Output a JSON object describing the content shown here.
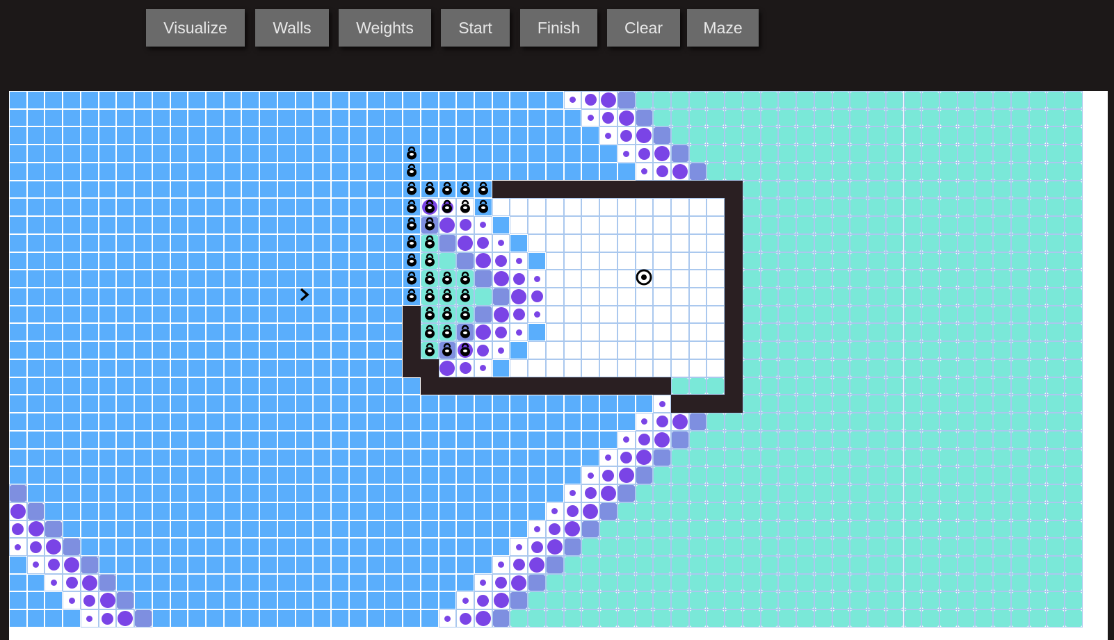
{
  "toolbar": {
    "buttons": [
      {
        "id": "visualize",
        "label": "Visualize"
      },
      {
        "id": "walls",
        "label": "Walls"
      },
      {
        "id": "weights",
        "label": "Weights"
      },
      {
        "id": "start",
        "label": "Start"
      },
      {
        "id": "finish",
        "label": "Finish"
      },
      {
        "id": "clear",
        "label": "Clear"
      },
      {
        "id": "maze",
        "label": "Maze"
      }
    ]
  },
  "grid": {
    "cols": 60,
    "rows": 30,
    "start_node": {
      "row": 11,
      "col": 16,
      "icon": "chevron-right-icon"
    },
    "finish_node": {
      "row": 10,
      "col": 35,
      "icon": "target-icon"
    },
    "colors": {
      "visited": "#5aaefc",
      "wave_teal": "#7ae8d8",
      "wave_aqua": "#8fd6d0",
      "wave_blue_violet": "#7e8fe0",
      "frontier_violet": "#7a44e6",
      "wall": "#2a1f22",
      "empty": "#ffffff",
      "grid_line": "#aac8ee"
    },
    "walls": [
      [
        5,
        27
      ],
      [
        5,
        28
      ],
      [
        5,
        29
      ],
      [
        5,
        30
      ],
      [
        5,
        31
      ],
      [
        5,
        32
      ],
      [
        5,
        33
      ],
      [
        5,
        34
      ],
      [
        5,
        35
      ],
      [
        5,
        36
      ],
      [
        5,
        37
      ],
      [
        5,
        38
      ],
      [
        5,
        39
      ],
      [
        5,
        40
      ],
      [
        6,
        40
      ],
      [
        7,
        40
      ],
      [
        8,
        40
      ],
      [
        9,
        40
      ],
      [
        10,
        40
      ],
      [
        11,
        40
      ],
      [
        12,
        40
      ],
      [
        13,
        40
      ],
      [
        14,
        40
      ],
      [
        15,
        40
      ],
      [
        16,
        40
      ],
      [
        12,
        22
      ],
      [
        13,
        22
      ],
      [
        14,
        22
      ],
      [
        15,
        22
      ],
      [
        15,
        23
      ],
      [
        16,
        23
      ],
      [
        16,
        24
      ],
      [
        16,
        25
      ],
      [
        16,
        26
      ],
      [
        16,
        27
      ],
      [
        16,
        28
      ],
      [
        16,
        29
      ],
      [
        16,
        30
      ],
      [
        16,
        31
      ],
      [
        16,
        32
      ],
      [
        16,
        33
      ],
      [
        16,
        34
      ],
      [
        16,
        35
      ],
      [
        16,
        36
      ],
      [
        17,
        37
      ],
      [
        17,
        38
      ],
      [
        17,
        39
      ],
      [
        17,
        40
      ]
    ],
    "weights": [
      [
        3,
        22
      ],
      [
        4,
        22
      ],
      [
        5,
        22
      ],
      [
        5,
        23
      ],
      [
        5,
        24
      ],
      [
        5,
        25
      ],
      [
        5,
        26
      ],
      [
        6,
        22
      ],
      [
        6,
        23
      ],
      [
        6,
        24
      ],
      [
        6,
        25
      ],
      [
        6,
        26
      ],
      [
        7,
        22
      ],
      [
        7,
        23
      ],
      [
        8,
        22
      ],
      [
        8,
        23
      ],
      [
        9,
        22
      ],
      [
        9,
        23
      ],
      [
        10,
        22
      ],
      [
        10,
        23
      ],
      [
        10,
        24
      ],
      [
        10,
        25
      ],
      [
        11,
        22
      ],
      [
        11,
        23
      ],
      [
        11,
        24
      ],
      [
        11,
        25
      ],
      [
        12,
        23
      ],
      [
        12,
        24
      ],
      [
        12,
        25
      ],
      [
        13,
        23
      ],
      [
        13,
        24
      ],
      [
        13,
        25
      ],
      [
        14,
        23
      ],
      [
        14,
        24
      ],
      [
        14,
        25
      ]
    ]
  }
}
